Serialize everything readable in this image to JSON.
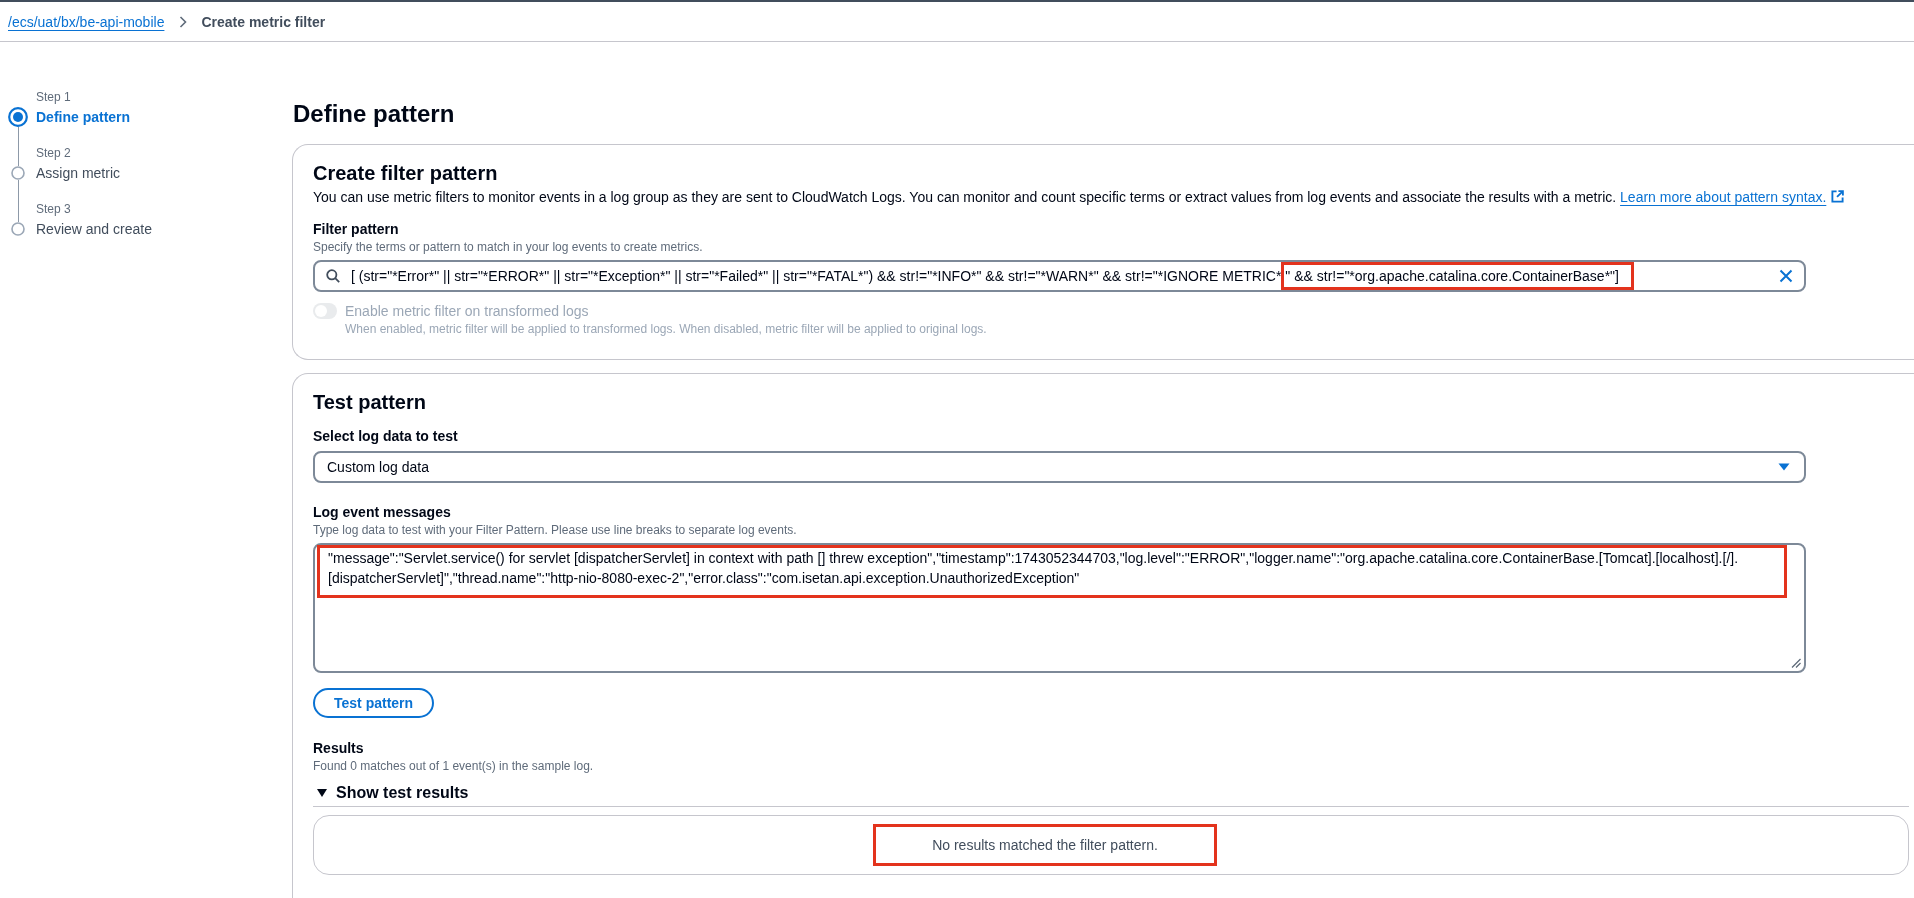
{
  "breadcrumbs": [
    {
      "text": "/ecs/uat/bx/be-api-mobile",
      "kind": "link"
    },
    {
      "text": "Create metric filter",
      "kind": "current"
    }
  ],
  "steps": [
    {
      "label": "Step 1",
      "title": "Define pattern",
      "selected": true
    },
    {
      "label": "Step 2",
      "title": "Assign metric",
      "selected": false
    },
    {
      "label": "Step 3",
      "title": "Review and create",
      "selected": false
    }
  ],
  "page_title": "Define pattern",
  "filter_section": {
    "title": "Create filter pattern",
    "description": "You can use metric filters to monitor events in a log group as they are sent to CloudWatch Logs. You can monitor and count specific terms or extract values from log events and associate the results with a metric.",
    "link": "Learn more about pattern syntax.",
    "filter_pattern": {
      "label": "Filter pattern",
      "hint": "Specify the terms or pattern to match in your log events to create metrics.",
      "value_parts": [
        {
          "text": "[ (str=\"*Error*\" || str=\"*ERROR*\" || str=\"*Exception*\" || str=\"*Failed*\" || str=\"*FATAL*\") && str!=\"*INFO*\" && str!=\"*WARN*\" && str!=\"*IGNORE METRIC*",
          "highlighted": false
        },
        {
          "text": "\" && str!=\"*org.apache.catalina.core.ContainerBase*\"]",
          "highlighted": true
        }
      ]
    },
    "transform_toggle": {
      "label": "Enable metric filter on transformed logs",
      "hint": "When enabled, metric filter will be applied to transformed logs. When disabled, metric filter will be applied to original logs.",
      "on": false,
      "disabled": true
    }
  },
  "test_section": {
    "title": "Test pattern",
    "log_source": {
      "label": "Select log data to test",
      "value": "Custom log data"
    },
    "log_messages": {
      "label": "Log event messages",
      "hint": "Type log data to test with your Filter Pattern. Please use line breaks to separate log events.",
      "value": "\"message\":\"Servlet.service() for servlet [dispatcherServlet] in context with path [] threw exception\",\"timestamp\":1743052344703,\"log.level\":\"ERROR\",\"logger.name\":\"org.apache.catalina.core.ContainerBase.[Tomcat].[localhost].[/].[dispatcherServlet]\",\"thread.name\":\"http-nio-8080-exec-2\",\"error.class\":\"com.isetan.api.exception.UnauthorizedException\"",
      "highlighted": true
    },
    "test_button": "Test pattern",
    "results": {
      "label": "Results",
      "summary": "Found 0 matches out of 1 event(s) in the sample log.",
      "toggle_label": "Show test results",
      "expanded": true,
      "empty_message": "No results matched the filter pattern.",
      "highlighted": true
    }
  }
}
